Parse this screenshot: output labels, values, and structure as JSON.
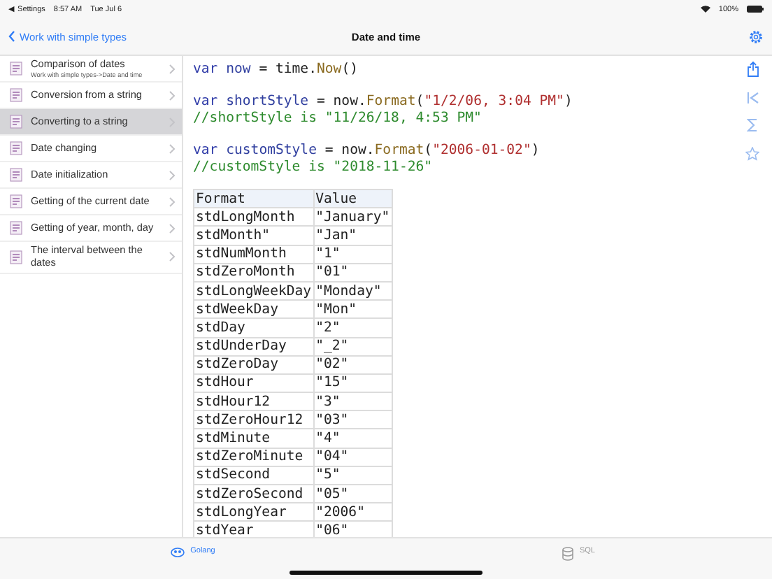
{
  "status_bar": {
    "back_app": "◀ Settings",
    "time": "8:57 AM",
    "date": "Tue Jul 6",
    "battery": "100%"
  },
  "nav_bar": {
    "back": "Work with simple types",
    "title": "Date and time"
  },
  "sidebar": {
    "items": [
      {
        "title": "Comparison of dates",
        "subtitle": "Work with simple types->Date and time",
        "selected": false
      },
      {
        "title": "Conversion from a string",
        "selected": false
      },
      {
        "title": "Converting to a string",
        "selected": true
      },
      {
        "title": "Date changing",
        "selected": false
      },
      {
        "title": "Date initialization",
        "selected": false
      },
      {
        "title": "Getting of the current date",
        "selected": false
      },
      {
        "title": "Getting of year, month, day",
        "selected": false
      },
      {
        "title": "The interval between the dates",
        "selected": false
      }
    ]
  },
  "code": [
    [
      [
        {
          "kind": "keyword",
          "text": "var"
        },
        {
          "kind": "ident",
          "text": " now"
        },
        {
          "kind": "plain",
          "text": " = time."
        },
        {
          "kind": "func",
          "text": "Now"
        },
        {
          "kind": "plain",
          "text": "()"
        }
      ]
    ],
    [
      [
        {
          "kind": "keyword",
          "text": "var"
        },
        {
          "kind": "ident",
          "text": " shortStyle"
        },
        {
          "kind": "plain",
          "text": " = now."
        },
        {
          "kind": "func",
          "text": "Format"
        },
        {
          "kind": "plain",
          "text": "("
        },
        {
          "kind": "string",
          "text": "\"1/2/06, 3:04 PM\""
        },
        {
          "kind": "plain",
          "text": ")"
        }
      ],
      [
        {
          "kind": "comment",
          "text": "//shortStyle is \"11/26/18, 4:53 PM\""
        }
      ]
    ],
    [
      [
        {
          "kind": "keyword",
          "text": "var"
        },
        {
          "kind": "ident",
          "text": " customStyle"
        },
        {
          "kind": "plain",
          "text": " = now."
        },
        {
          "kind": "func",
          "text": "Format"
        },
        {
          "kind": "plain",
          "text": "("
        },
        {
          "kind": "string",
          "text": "\"2006-01-02\""
        },
        {
          "kind": "plain",
          "text": ")"
        }
      ],
      [
        {
          "kind": "comment",
          "text": "//customStyle is \"2018-11-26\""
        }
      ]
    ]
  ],
  "table": {
    "columns": [
      "Format",
      "Value"
    ],
    "rows": [
      [
        "stdLongMonth",
        "\"January\""
      ],
      [
        "stdMonth\"",
        "\"Jan\""
      ],
      [
        "stdNumMonth",
        "\"1\""
      ],
      [
        "stdZeroMonth",
        "\"01\""
      ],
      [
        "stdLongWeekDay",
        "\"Monday\""
      ],
      [
        "stdWeekDay",
        "\"Mon\""
      ],
      [
        "stdDay",
        "\"2\""
      ],
      [
        "stdUnderDay",
        "\"_2\""
      ],
      [
        "stdZeroDay",
        "\"02\""
      ],
      [
        "stdHour",
        "\"15\""
      ],
      [
        "stdHour12",
        "\"3\""
      ],
      [
        "stdZeroHour12",
        "\"03\""
      ],
      [
        "stdMinute",
        "\"4\""
      ],
      [
        "stdZeroMinute",
        "\"04\""
      ],
      [
        "stdSecond",
        "\"5\""
      ],
      [
        "stdZeroSecond",
        "\"05\""
      ],
      [
        "stdLongYear",
        "\"2006\""
      ],
      [
        "stdYear",
        "\"06\""
      ]
    ]
  },
  "tab_bar": [
    {
      "label": "Golang",
      "kind": "gopher",
      "selected": true
    },
    {
      "label": "SQL",
      "kind": "database",
      "selected": false
    }
  ]
}
